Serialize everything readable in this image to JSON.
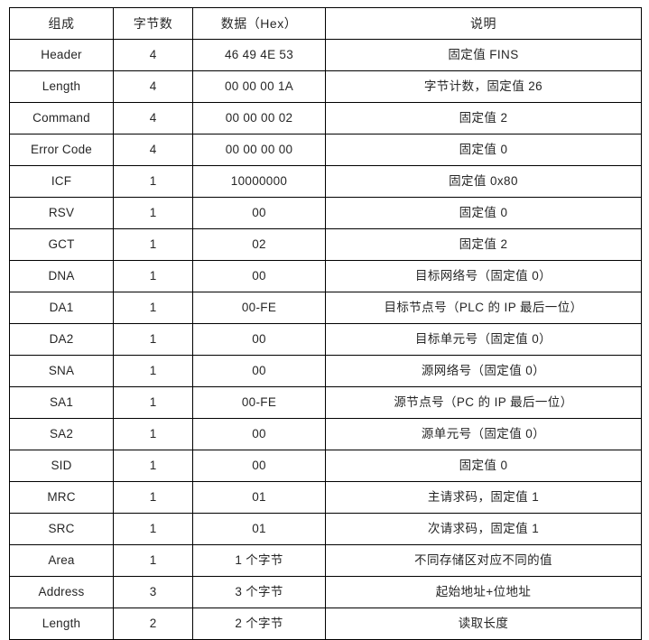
{
  "table": {
    "title_visible": false,
    "columns": [
      {
        "key": "name",
        "label": "组成"
      },
      {
        "key": "bytes",
        "label": "字节数"
      },
      {
        "key": "data",
        "label": "数据（Hex）"
      },
      {
        "key": "desc",
        "label": "说明"
      }
    ],
    "rows": [
      {
        "name": "Header",
        "bytes": "4",
        "data": "46 49 4E 53",
        "desc": "固定值 FINS"
      },
      {
        "name": "Length",
        "bytes": "4",
        "data": "00 00 00 1A",
        "desc": "字节计数，固定值 26"
      },
      {
        "name": "Command",
        "bytes": "4",
        "data": "00 00 00 02",
        "desc": "固定值 2"
      },
      {
        "name": "Error Code",
        "bytes": "4",
        "data": "00 00 00 00",
        "desc": "固定值 0"
      },
      {
        "name": "ICF",
        "bytes": "1",
        "data": "10000000",
        "desc": "固定值 0x80"
      },
      {
        "name": "RSV",
        "bytes": "1",
        "data": "00",
        "desc": "固定值 0"
      },
      {
        "name": "GCT",
        "bytes": "1",
        "data": "02",
        "desc": "固定值 2"
      },
      {
        "name": "DNA",
        "bytes": "1",
        "data": "00",
        "desc": "目标网络号（固定值 0）"
      },
      {
        "name": "DA1",
        "bytes": "1",
        "data": "00-FE",
        "desc": "目标节点号（PLC 的 IP 最后一位）"
      },
      {
        "name": "DA2",
        "bytes": "1",
        "data": "00",
        "desc": "目标单元号（固定值 0）"
      },
      {
        "name": "SNA",
        "bytes": "1",
        "data": "00",
        "desc": "源网络号（固定值 0）"
      },
      {
        "name": "SA1",
        "bytes": "1",
        "data": "00-FE",
        "desc": "源节点号（PC 的 IP 最后一位）"
      },
      {
        "name": "SA2",
        "bytes": "1",
        "data": "00",
        "desc": "源单元号（固定值 0）"
      },
      {
        "name": "SID",
        "bytes": "1",
        "data": "00",
        "desc": "固定值 0"
      },
      {
        "name": "MRC",
        "bytes": "1",
        "data": "01",
        "desc": "主请求码，固定值 1"
      },
      {
        "name": "SRC",
        "bytes": "1",
        "data": "01",
        "desc": "次请求码，固定值 1"
      },
      {
        "name": "Area",
        "bytes": "1",
        "data": "1 个字节",
        "desc": "不同存储区对应不同的值"
      },
      {
        "name": "Address",
        "bytes": "3",
        "data": "3 个字节",
        "desc": "起始地址+位地址"
      },
      {
        "name": "Length",
        "bytes": "2",
        "data": "2 个字节",
        "desc": "读取长度"
      }
    ]
  },
  "style": {
    "border_color": "#000000",
    "text_color": "#262626",
    "background": "#ffffff"
  }
}
